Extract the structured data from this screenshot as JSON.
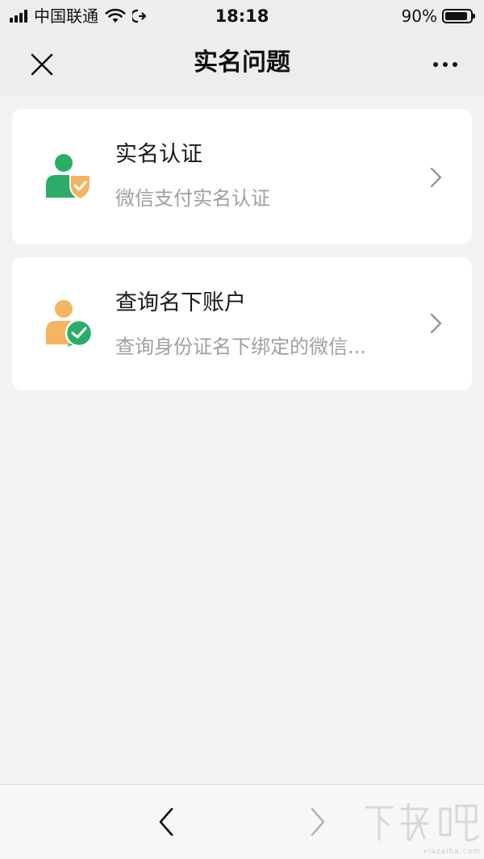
{
  "status_bar": {
    "carrier": "中国联通",
    "time": "18:18",
    "battery_percent_label": "90%",
    "battery_level": 0.9,
    "icons": [
      "signal-icon",
      "wifi-icon",
      "call-forward-icon",
      "battery-icon"
    ]
  },
  "nav": {
    "title": "实名问题",
    "close_icon": "close-icon",
    "more_icon": "more-icon"
  },
  "cards": [
    {
      "title": "实名认证",
      "subtitle": "微信支付实名认证",
      "icon": "verified-user-icon",
      "colors": {
        "person": "#2aae67",
        "badge": "#f5b461"
      }
    },
    {
      "title": "查询名下账户",
      "subtitle": "查询身份证名下绑定的微信...",
      "icon": "user-wechat-icon",
      "colors": {
        "person": "#f5b461",
        "badge": "#2aae67"
      }
    }
  ],
  "bottom_bar": {
    "back_icon": "chevron-left-icon",
    "forward_icon": "chevron-right-icon"
  },
  "watermark": {
    "text": "xiazaiba.com",
    "logo_text": "下载吧"
  }
}
